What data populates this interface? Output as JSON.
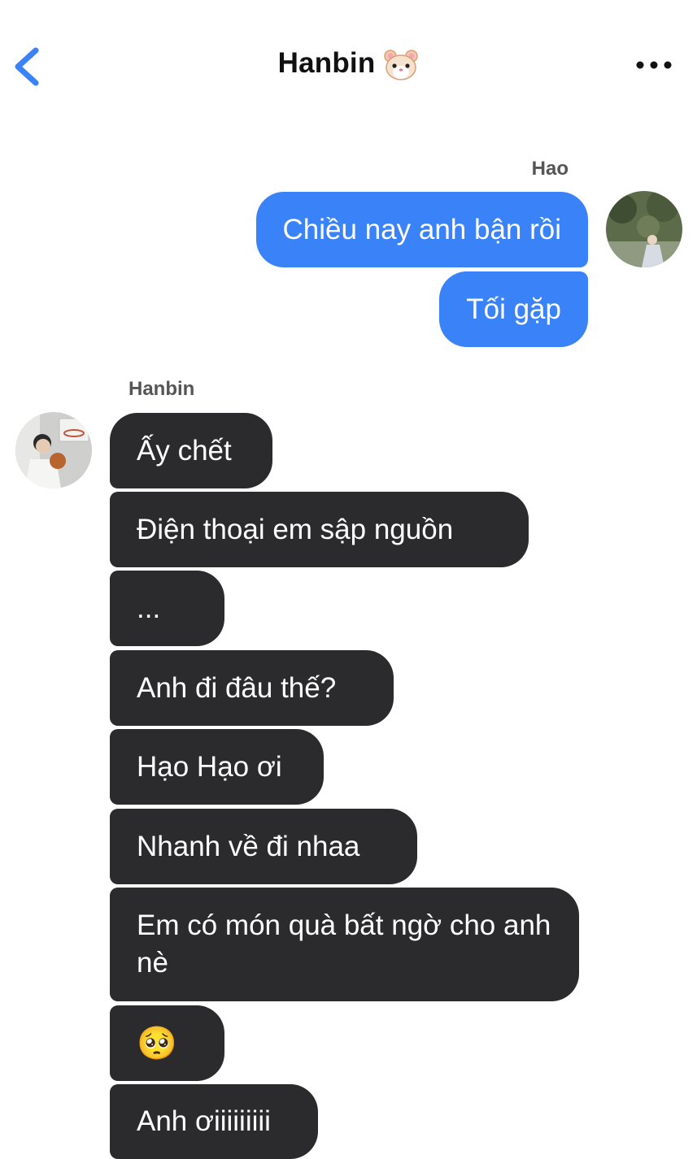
{
  "header": {
    "title": "Hanbin",
    "title_emoji": "hamster-face-icon"
  },
  "outgoing": {
    "sender": "Hao",
    "messages": [
      "Chiều nay anh bận rồi",
      "Tối gặp"
    ]
  },
  "incoming": {
    "sender": "Hanbin",
    "messages": [
      "Ấy chết",
      "Điện thoại em sập nguồn",
      "...",
      "Anh đi đâu thế?",
      "Hạo Hạo ơi",
      "Nhanh về đi nhaa",
      "Em có món quà bất ngờ cho anh nè",
      "🥺",
      "Anh ơiiiiiiiii"
    ]
  },
  "colors": {
    "accent": "#3a82f7",
    "incoming_bubble": "#2b2b2d",
    "outgoing_bubble": "#3a82f7"
  }
}
